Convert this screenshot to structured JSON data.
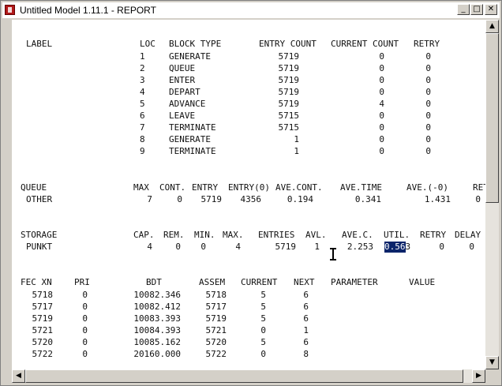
{
  "window": {
    "title": "Untitled Model 1.11.1 - REPORT",
    "buttons": {
      "minimize": "_",
      "maximize": "□",
      "close": "✕"
    }
  },
  "blocks": {
    "headers": [
      "LABEL",
      "LOC",
      "BLOCK TYPE",
      "ENTRY COUNT",
      "CURRENT COUNT",
      "RETRY"
    ],
    "rows": [
      [
        "",
        "1",
        "GENERATE",
        "5719",
        "0",
        "0"
      ],
      [
        "",
        "2",
        "QUEUE",
        "5719",
        "0",
        "0"
      ],
      [
        "",
        "3",
        "ENTER",
        "5719",
        "0",
        "0"
      ],
      [
        "",
        "4",
        "DEPART",
        "5719",
        "0",
        "0"
      ],
      [
        "",
        "5",
        "ADVANCE",
        "5719",
        "4",
        "0"
      ],
      [
        "",
        "6",
        "LEAVE",
        "5715",
        "0",
        "0"
      ],
      [
        "",
        "7",
        "TERMINATE",
        "5715",
        "0",
        "0"
      ],
      [
        "",
        "8",
        "GENERATE",
        "1",
        "0",
        "0"
      ],
      [
        "",
        "9",
        "TERMINATE",
        "1",
        "0",
        "0"
      ]
    ]
  },
  "queue": {
    "headers": [
      "QUEUE",
      "MAX",
      "CONT.",
      "ENTRY",
      "ENTRY(0)",
      "AVE.CONT.",
      "AVE.TIME",
      "AVE.(-0)",
      "RETR"
    ],
    "rows": [
      [
        "OTHER",
        "7",
        "0",
        "5719",
        "4356",
        "0.194",
        "0.341",
        "1.431",
        "0"
      ]
    ]
  },
  "storage": {
    "headers": [
      "STORAGE",
      "CAP.",
      "REM.",
      "MIN.",
      "MAX.",
      "ENTRIES",
      "AVL.",
      "AVE.C.",
      "UTIL.",
      "RETRY",
      "DELAY"
    ],
    "rows": [
      [
        "PUNKT",
        "4",
        "0",
        "0",
        "4",
        "5719",
        "1",
        "2.253",
        "0.563",
        "0",
        "0"
      ]
    ],
    "util_selected": "0.56",
    "util_rest": "3"
  },
  "fec": {
    "headers": [
      "FEC XN",
      "PRI",
      "BDT",
      "ASSEM",
      "CURRENT",
      "NEXT",
      "PARAMETER",
      "VALUE"
    ],
    "rows": [
      [
        "5718",
        "0",
        "10082.346",
        "5718",
        "5",
        "6"
      ],
      [
        "5717",
        "0",
        "10082.412",
        "5717",
        "5",
        "6"
      ],
      [
        "5719",
        "0",
        "10083.393",
        "5719",
        "5",
        "6"
      ],
      [
        "5721",
        "0",
        "10084.393",
        "5721",
        "0",
        "1"
      ],
      [
        "5720",
        "0",
        "10085.162",
        "5720",
        "5",
        "6"
      ],
      [
        "5722",
        "0",
        "20160.000",
        "5722",
        "0",
        "8"
      ]
    ]
  }
}
